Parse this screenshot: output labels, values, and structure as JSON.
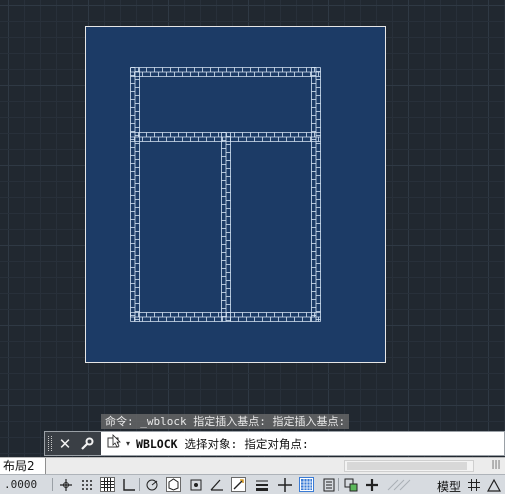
{
  "command_line": {
    "history": "命令: _wblock 指定插入基点: 指定插入基点:",
    "command_name": "WBLOCK",
    "prompt": "选择对象: 指定对角点:"
  },
  "layout_tabs": [
    {
      "label": "布局2"
    }
  ],
  "status_bar": {
    "coordinate_text": ".0000",
    "space_label": "模型"
  },
  "colors": {
    "canvas_background": "#212830",
    "paper_background": "#1c3b66",
    "drawing_lines": "#d8e6f5",
    "command_history_background": "#6e6e6e"
  }
}
